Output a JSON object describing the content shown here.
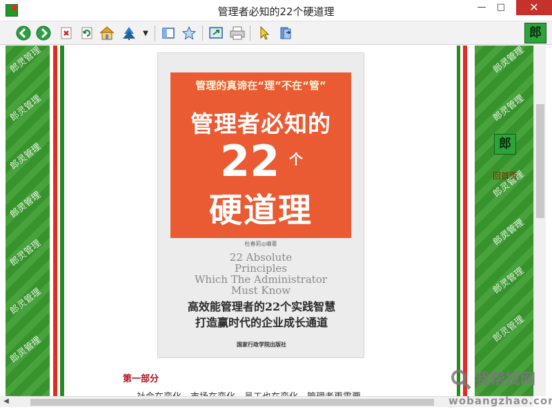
{
  "window": {
    "title": "管理者必知的22个硬道理",
    "minimize": "—",
    "maximize": "□",
    "close": "✕"
  },
  "toolbar": {
    "buttons": [
      {
        "name": "back",
        "icon": "arrow-left-icon"
      },
      {
        "name": "forward",
        "icon": "arrow-right-icon"
      },
      {
        "name": "stop",
        "icon": "stop-icon"
      },
      {
        "name": "refresh",
        "icon": "refresh-icon"
      },
      {
        "name": "home",
        "icon": "home-icon"
      },
      {
        "name": "bookmarks",
        "icon": "bookmark-tree-icon"
      },
      {
        "name": "dropdown",
        "icon": "chevron-down-icon"
      },
      {
        "name": "panel",
        "icon": "sidebar-icon"
      },
      {
        "name": "favorite",
        "icon": "star-icon"
      },
      {
        "name": "fullscreen",
        "icon": "fullscreen-icon"
      },
      {
        "name": "print",
        "icon": "print-icon"
      },
      {
        "name": "pointer",
        "icon": "cursor-icon"
      },
      {
        "name": "book",
        "icon": "book-icon"
      }
    ],
    "brand": "郎"
  },
  "sidebar": {
    "watermark": "郎灵管理",
    "brand": "郎",
    "home_link": "回首页"
  },
  "cover": {
    "subtitle": "管理的真谛在“理”不在“管”",
    "title_line1": "管理者必知的",
    "title_number": "22",
    "title_ge": "个",
    "title_line3": "硬道理",
    "author": "杜春莉◎编著",
    "english": [
      "22 Absolute",
      "Principles",
      "Which The Administrator",
      "Must Know"
    ],
    "tagline1": "高效能管理者的22个实践智慧",
    "tagline2": "打造赢时代的企业成长通道",
    "publisher": "国家行政学院出版社"
  },
  "content": {
    "part_title": "第一部分",
    "body_preview": "社会在变化，市场在变化，员工也在变化，管理者更需要……"
  },
  "site": {
    "name": "我帮找网",
    "url": "wobangzhao.com"
  },
  "colors": {
    "accent_green": "#3a9b2d",
    "accent_red": "#e52b1f",
    "cover_orange": "#ea5b33"
  }
}
